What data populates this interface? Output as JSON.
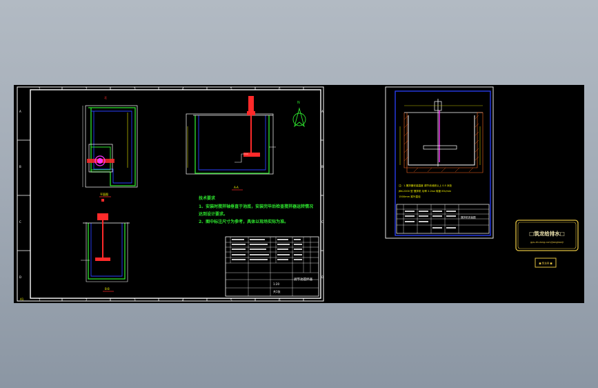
{
  "viewer": {
    "background_top": "#b2bac3",
    "background_bottom": "#8b96a3",
    "canvas_color": "#000000"
  },
  "sheet_left": {
    "section_label_top": "A-A",
    "plan_label": "平面图",
    "section_label_bottom": "B-B",
    "notes_title": "技术要求",
    "notes": [
      "1、安装时搅拌轴垂直于池底，安装完毕后检查搅拌器运转情况",
      "   达到设计要求。",
      "2、图中标注尺寸为参考，具体以现场实际为准。"
    ],
    "title_block_name": "调节池搅拌器",
    "title_block_scale": "1:20",
    "title_block_sheet": "共1张",
    "corner_tag": "A1"
  },
  "sheet_right": {
    "note_lines": [
      "注：1.搅拌器安装高度  调节池池底以上  0.5  米处",
      "JBK-2200  型  搅拌机  功率  2.2kw  转速  85r/min",
      "1500mm  桨叶直径"
    ],
    "title_block_name": "搅拌机安装图"
  },
  "stamp": {
    "title": "□筑龙给排水□",
    "subtitle": "gps.zhulong.com/jiangbanji",
    "tag": "■ 筑龙网 ■"
  },
  "colors": {
    "frame": "#ffffff",
    "wall_green": "#2ee62e",
    "yellow": "#f2f200",
    "red": "#ff2a2a",
    "blue": "#2a40ff",
    "magenta": "#ff30ff",
    "cyan": "#30e0e0",
    "stamp_gold": "#e0c040"
  }
}
